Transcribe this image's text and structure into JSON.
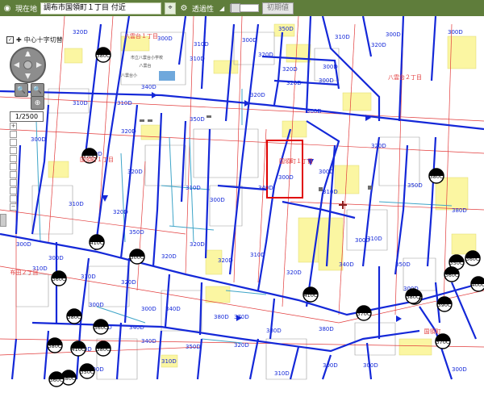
{
  "toolbar": {
    "location_label": "現在地",
    "location_value": "調布市国領町１丁目 付近",
    "transparency_label": "透過性",
    "reset_button": "初期値"
  },
  "map_controls": {
    "crosshair_toggle": "中心十字切替",
    "scale": "1/2500"
  },
  "colors": {
    "toolbar": "#5f7d3b",
    "pipe_blue": "#1428d8",
    "pipe_cyan": "#3fa5c8",
    "parcel_red": "#e23b3b",
    "highlight_yellow": "#fbf6a2",
    "selection_red": "#e00000"
  },
  "map": {
    "area_labels": [
      "八雲台１丁目",
      "八雲台２丁目",
      "国領町１丁目",
      "国領町１丁目",
      "布田２丁目",
      "国領町"
    ],
    "pipe_labels": [
      "320D",
      "300D",
      "310D",
      "300D",
      "350D",
      "310D",
      "320D",
      "300D",
      "300D",
      "320D",
      "300D",
      "320D",
      "310D",
      "320D",
      "300D",
      "310D",
      "310D",
      "350D",
      "320D",
      "350D",
      "300D",
      "320D",
      "300D",
      "320D",
      "340D",
      "320D",
      "300D",
      "300D",
      "310D",
      "340D",
      "300D",
      "310D",
      "310D",
      "320D",
      "350D",
      "350D",
      "310D",
      "300D",
      "310D",
      "320D",
      "320D",
      "320D",
      "320D",
      "340D",
      "350D",
      "300D",
      "300D",
      "310D",
      "310D",
      "320D",
      "380D",
      "300D",
      "300D",
      "340D",
      "300D",
      "340D",
      "360D",
      "380D",
      "370D",
      "380D",
      "380D",
      "320D",
      "340D",
      "350D",
      "310D",
      "300D",
      "300D",
      "320D",
      "310D",
      "300D",
      "300D"
    ],
    "manholes": [
      "380C",
      "370C",
      "380C",
      "410C",
      "300C",
      "360C",
      "350C",
      "360C",
      "360C",
      "350C",
      "390C",
      "410C",
      "380C",
      "370C",
      "380C",
      "410C",
      "380C",
      "380C",
      "350C",
      "380C",
      "400C",
      "370C",
      "360C",
      "360C"
    ],
    "facility_labels": [
      "市立八雲台小学校",
      "八雲台",
      "八雲台小"
    ]
  }
}
